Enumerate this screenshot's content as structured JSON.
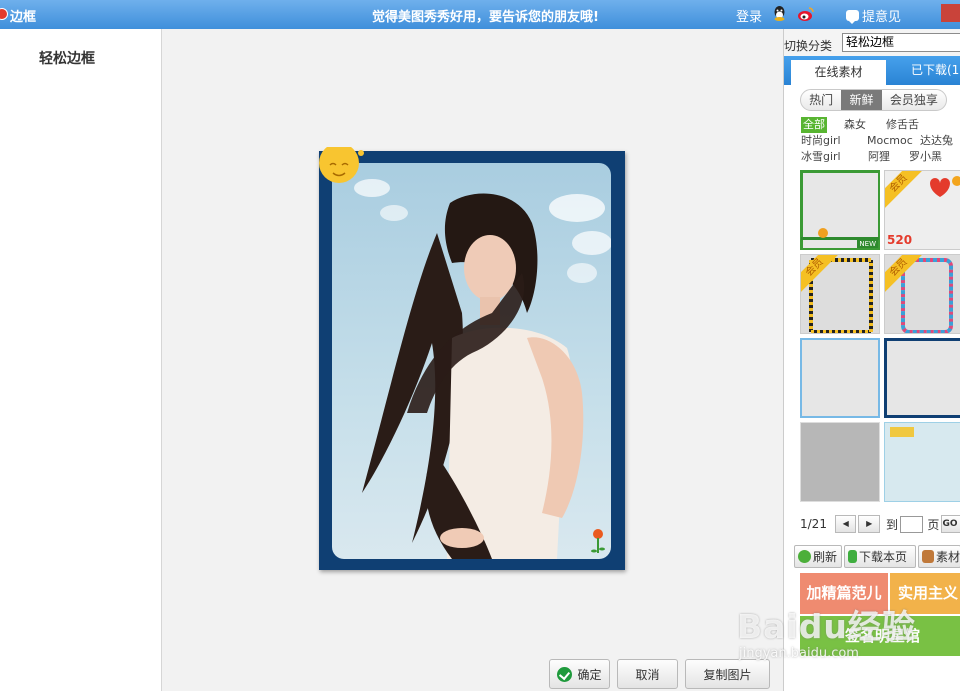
{
  "titlebar": {
    "title": "边框",
    "slogan": "觉得美图秀秀好用，要告诉您的朋友哦!",
    "login": "登录",
    "feedback": "提意见"
  },
  "sidebar": {
    "title": "轻松边框"
  },
  "canvas": {
    "buttons": {
      "ok": "确定",
      "cancel": "取消",
      "copy": "复制图片"
    }
  },
  "right_panel": {
    "category_label": "切换分类",
    "category_value": "轻松边框",
    "tabs": {
      "online": "在线素材",
      "downloaded": "已下载(1"
    },
    "segments": [
      "热门",
      "新鲜",
      "会员独享"
    ],
    "active_segment": "新鲜",
    "filters": [
      "全部",
      "森女",
      "修舌舌",
      "时尚girl",
      "Mocmoc",
      "达达兔",
      "冰雪girl",
      "阿狸",
      "罗小黑"
    ],
    "active_filter": "全部",
    "thumb_badges": {
      "new": "NEW",
      "member": "会员",
      "text_520": "520"
    },
    "pager": {
      "page": "1/21",
      "goto": "到",
      "page_unit": "页",
      "go": "GO"
    },
    "actions": {
      "refresh": "刷新",
      "download_page": "下载本页",
      "material": "素材"
    },
    "banners": {
      "b1": "加精篇范儿",
      "b2": "实用主义",
      "b3": "签名明星馆"
    }
  },
  "watermark": {
    "text": "Baidu经验",
    "url": "jingyan.baidu.com"
  },
  "colors": {
    "titlebar": "#3f8fdb",
    "frame": "#0f3f73",
    "accent_green": "#58b531",
    "tab_blue": "#2a83d4"
  }
}
